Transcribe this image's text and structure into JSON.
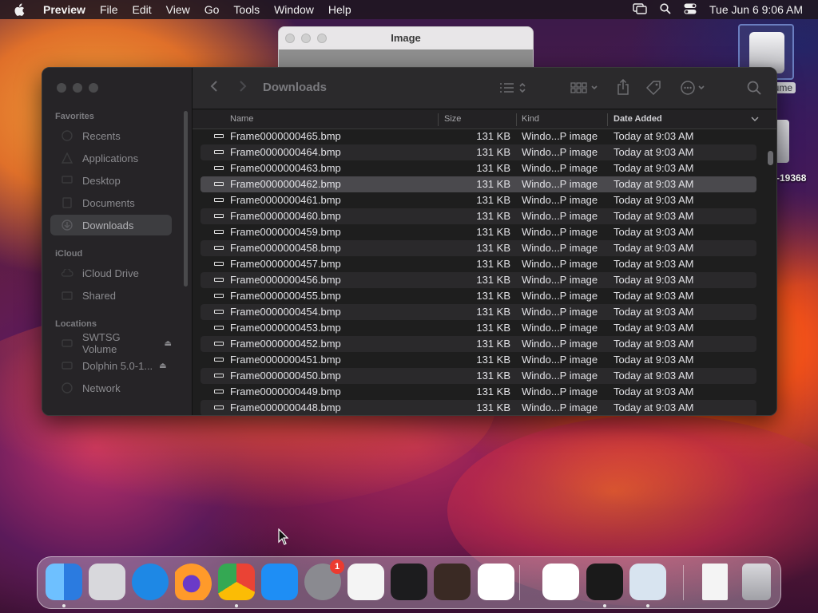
{
  "menubar": {
    "app_name": "Preview",
    "menus": [
      "File",
      "Edit",
      "View",
      "Go",
      "Tools",
      "Window",
      "Help"
    ],
    "datetime": "Tue Jun 6  9:06 AM"
  },
  "preview_window": {
    "title": "Image"
  },
  "desktop": {
    "drive_label": "lume",
    "drive2_label": "-19368"
  },
  "finder": {
    "title": "Downloads",
    "sidebar": {
      "favorites_label": "Favorites",
      "favorites": [
        "Recents",
        "Applications",
        "Desktop",
        "Documents",
        "Downloads"
      ],
      "icloud_label": "iCloud",
      "icloud": [
        "iCloud Drive",
        "Shared"
      ],
      "locations_label": "Locations",
      "locations": [
        "SWTSG Volume",
        "Dolphin 5.0-1...",
        "Network"
      ]
    },
    "columns": {
      "name": "Name",
      "size": "Size",
      "kind": "Kind",
      "date": "Date Added"
    },
    "rows": [
      {
        "name": "Frame0000000465.bmp",
        "size": "131 KB",
        "kind": "Windo...P image",
        "date": "Today at 9:03 AM"
      },
      {
        "name": "Frame0000000464.bmp",
        "size": "131 KB",
        "kind": "Windo...P image",
        "date": "Today at 9:03 AM"
      },
      {
        "name": "Frame0000000463.bmp",
        "size": "131 KB",
        "kind": "Windo...P image",
        "date": "Today at 9:03 AM"
      },
      {
        "name": "Frame0000000462.bmp",
        "size": "131 KB",
        "kind": "Windo...P image",
        "date": "Today at 9:03 AM"
      },
      {
        "name": "Frame0000000461.bmp",
        "size": "131 KB",
        "kind": "Windo...P image",
        "date": "Today at 9:03 AM"
      },
      {
        "name": "Frame0000000460.bmp",
        "size": "131 KB",
        "kind": "Windo...P image",
        "date": "Today at 9:03 AM"
      },
      {
        "name": "Frame0000000459.bmp",
        "size": "131 KB",
        "kind": "Windo...P image",
        "date": "Today at 9:03 AM"
      },
      {
        "name": "Frame0000000458.bmp",
        "size": "131 KB",
        "kind": "Windo...P image",
        "date": "Today at 9:03 AM"
      },
      {
        "name": "Frame0000000457.bmp",
        "size": "131 KB",
        "kind": "Windo...P image",
        "date": "Today at 9:03 AM"
      },
      {
        "name": "Frame0000000456.bmp",
        "size": "131 KB",
        "kind": "Windo...P image",
        "date": "Today at 9:03 AM"
      },
      {
        "name": "Frame0000000455.bmp",
        "size": "131 KB",
        "kind": "Windo...P image",
        "date": "Today at 9:03 AM"
      },
      {
        "name": "Frame0000000454.bmp",
        "size": "131 KB",
        "kind": "Windo...P image",
        "date": "Today at 9:03 AM"
      },
      {
        "name": "Frame0000000453.bmp",
        "size": "131 KB",
        "kind": "Windo...P image",
        "date": "Today at 9:03 AM"
      },
      {
        "name": "Frame0000000452.bmp",
        "size": "131 KB",
        "kind": "Windo...P image",
        "date": "Today at 9:03 AM"
      },
      {
        "name": "Frame0000000451.bmp",
        "size": "131 KB",
        "kind": "Windo...P image",
        "date": "Today at 9:03 AM"
      },
      {
        "name": "Frame0000000450.bmp",
        "size": "131 KB",
        "kind": "Windo...P image",
        "date": "Today at 9:03 AM"
      },
      {
        "name": "Frame0000000449.bmp",
        "size": "131 KB",
        "kind": "Windo...P image",
        "date": "Today at 9:03 AM"
      },
      {
        "name": "Frame0000000448.bmp",
        "size": "131 KB",
        "kind": "Windo...P image",
        "date": "Today at 9:03 AM"
      }
    ],
    "selected_row": "Frame0000000462.bmp"
  },
  "dock": {
    "apps": [
      {
        "icon": "finder-icon",
        "color": "#2b8cf0",
        "running": true
      },
      {
        "icon": "launchpad-icon",
        "color": "#d8d8dc",
        "running": false
      },
      {
        "icon": "safari-icon",
        "color": "#1e88e5",
        "running": false
      },
      {
        "icon": "firefox-icon",
        "color": "#ff7a1a",
        "running": false
      },
      {
        "icon": "chrome-icon",
        "color": "#ffffff",
        "running": true
      },
      {
        "icon": "app-store-icon",
        "color": "#1e8ef5",
        "running": false
      },
      {
        "icon": "system-settings-icon",
        "color": "#8a8a90",
        "running": false,
        "badge": "1"
      },
      {
        "icon": "textedit-icon",
        "color": "#f4f4f4",
        "running": false
      },
      {
        "icon": "terminal-icon",
        "color": "#1c1c1e",
        "running": false
      },
      {
        "icon": "garageband-icon",
        "color": "#3a2a24",
        "running": false
      },
      {
        "icon": "vscode-icon",
        "color": "#ffffff",
        "running": false
      },
      {
        "icon": "visual-studio-icon",
        "color": "#ffffff",
        "running": false
      },
      {
        "icon": "ffmpeg-app-icon",
        "color": "#1a1a1a",
        "running": true
      },
      {
        "icon": "preview-icon",
        "color": "#d8e4f0",
        "running": true
      },
      {
        "icon": "downloads-stack-icon",
        "color": "#f0f0f0",
        "running": false
      },
      {
        "icon": "trash-icon",
        "color": "#c8c8cc",
        "running": false
      }
    ]
  }
}
